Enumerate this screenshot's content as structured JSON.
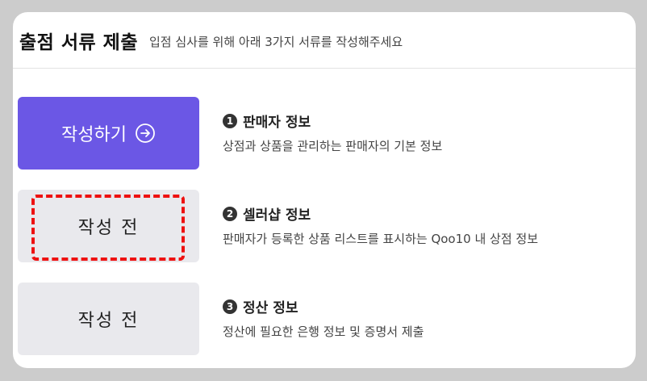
{
  "header": {
    "title": "출점 서류 제출",
    "subtitle": "입점 심사를 위해 아래 3가지 서류를 작성해주세요"
  },
  "steps": [
    {
      "number": "1",
      "title": "판매자 정보",
      "description": "상점과 상품을 관리하는 판매자의 기본 정보",
      "button_label": "작성하기",
      "button_icon": "arrow-right-circle-icon",
      "state": "active"
    },
    {
      "number": "2",
      "title": "셀러샵 정보",
      "description": "판매자가 등록한 상품 리스트를 표시하는 Qoo10 내 상점 정보",
      "button_label": "작성 전",
      "state": "pending",
      "highlighted": true
    },
    {
      "number": "3",
      "title": "정산 정보",
      "description": "정산에 필요한 은행 정보 및 증명서 제출",
      "button_label": "작성 전",
      "state": "pending"
    }
  ],
  "colors": {
    "primary": "#6b57e5",
    "pending_bg": "#e9e9ed",
    "highlight_border": "#ee1111",
    "page_bg": "#cccccc"
  }
}
